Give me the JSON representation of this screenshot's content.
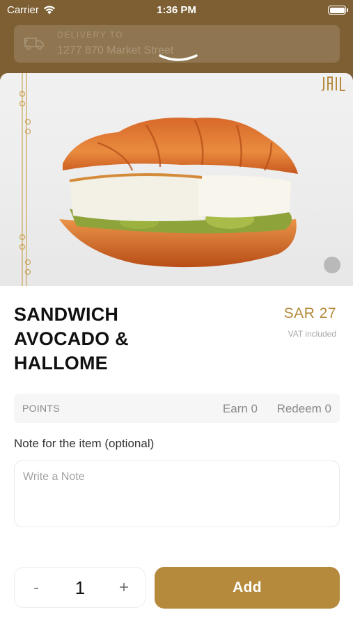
{
  "status_bar": {
    "carrier": "Carrier",
    "time": "1:36 PM"
  },
  "delivery": {
    "label": "DELIVERY TO",
    "address": "1277 870 Market Street"
  },
  "brand": {
    "accent_color": "#b58a3c",
    "header_color": "#7d5f33"
  },
  "product": {
    "title": "SANDWICH AVOCADO & HALLOME",
    "price": "SAR 27",
    "vat_note": "VAT included"
  },
  "points": {
    "label": "POINTS",
    "earn": "Earn 0",
    "redeem": "Redeem 0"
  },
  "note": {
    "label": "Note for the item (optional)",
    "placeholder": "Write a Note",
    "value": ""
  },
  "quantity": {
    "minus": "-",
    "value": "1",
    "plus": "+"
  },
  "actions": {
    "add_label": "Add"
  }
}
